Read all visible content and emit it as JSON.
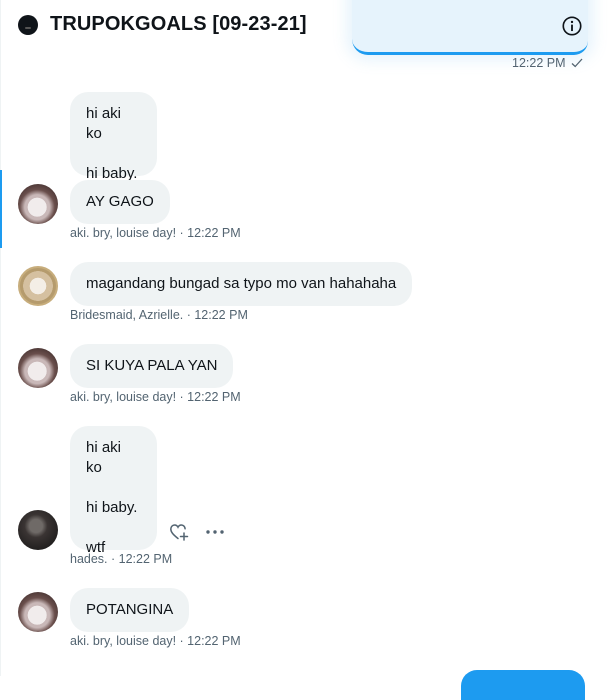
{
  "header": {
    "title": "TRUPOKGOALS [09-23-21]",
    "info_icon": "info-icon"
  },
  "sent_message": {
    "time": "12:22 PM",
    "status_icon": "checkmark-icon"
  },
  "messages": [
    {
      "lines": [
        "hi aki ko",
        "hi baby."
      ]
    },
    {
      "lines": [
        "AY GAGO"
      ],
      "meta": "aki. bry, louise day! · 12:22 PM"
    },
    {
      "lines": [
        "magandang bungad sa typo mo van hahahaha"
      ],
      "meta": "Bridesmaid, Azrielle. · 12:22 PM"
    },
    {
      "lines": [
        "SI KUYA PALA YAN"
      ],
      "meta": "aki. bry, louise day! · 12:22 PM"
    },
    {
      "lines": [
        "hi aki ko",
        "hi baby.",
        "wtf"
      ],
      "meta": "hades. · 12:22 PM"
    },
    {
      "lines": [
        "POTANGINA"
      ],
      "meta": "aki. bry, louise day! · 12:22 PM"
    }
  ],
  "actions": {
    "react_icon": "heart-plus-icon",
    "more_icon": "more-icon"
  },
  "colors": {
    "accent": "#1d9bf0",
    "bubble": "#eff3f4",
    "meta": "#536471"
  }
}
